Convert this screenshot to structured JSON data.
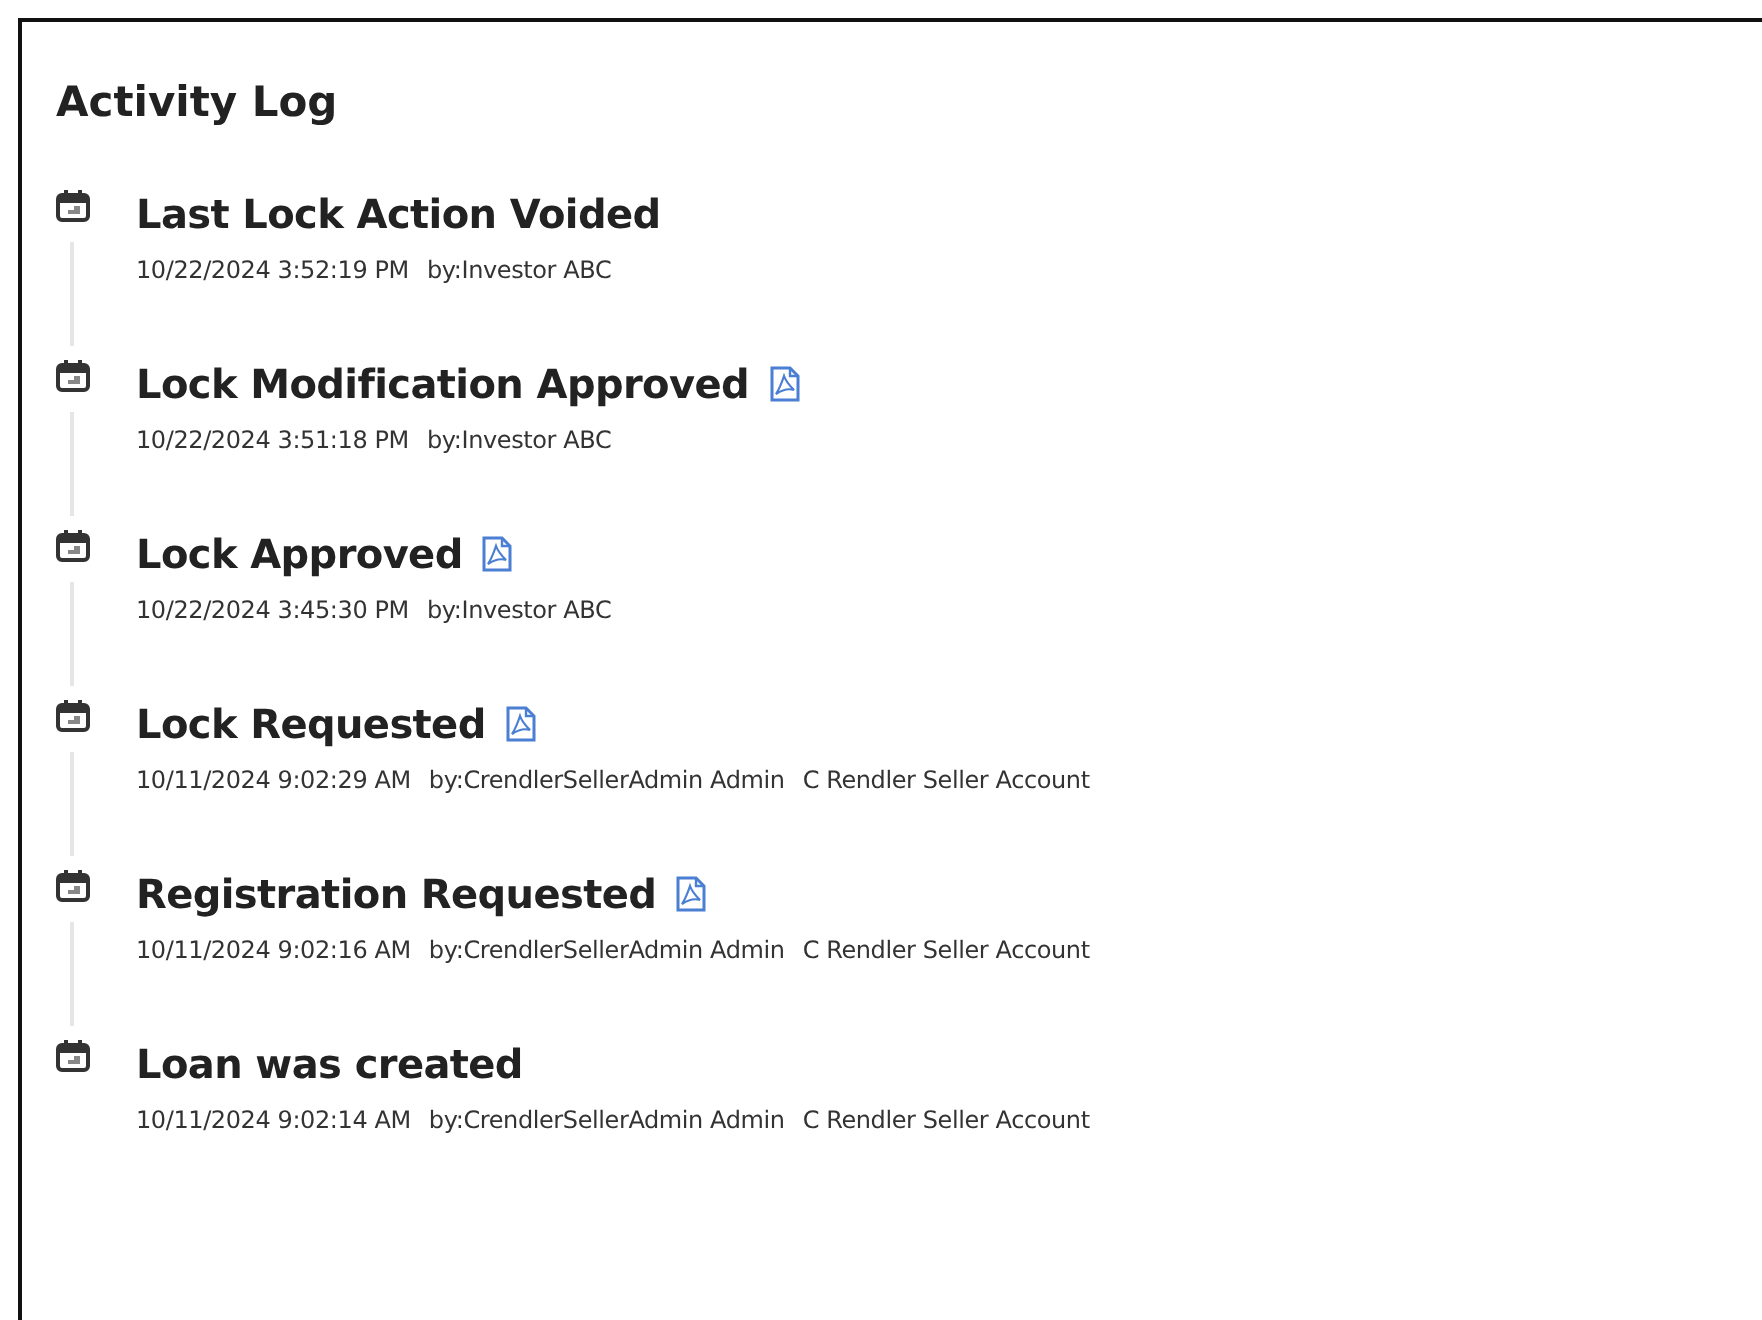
{
  "title": "Activity Log",
  "entries": [
    {
      "title": "Last Lock Action Voided",
      "attachment": false,
      "meta": [
        "10/22/2024 3:52:19 PM",
        "by:Investor ABC"
      ]
    },
    {
      "title": "Lock Modification Approved",
      "attachment": true,
      "meta": [
        "10/22/2024 3:51:18 PM",
        "by:Investor ABC"
      ]
    },
    {
      "title": "Lock Approved",
      "attachment": true,
      "meta": [
        "10/22/2024 3:45:30 PM",
        "by:Investor ABC"
      ]
    },
    {
      "title": "Lock Requested",
      "attachment": true,
      "meta": [
        "10/11/2024 9:02:29 AM",
        "by:CrendlerSellerAdmin Admin",
        "C Rendler Seller Account"
      ]
    },
    {
      "title": "Registration Requested",
      "attachment": true,
      "meta": [
        "10/11/2024 9:02:16 AM",
        "by:CrendlerSellerAdmin Admin",
        "C Rendler Seller Account"
      ]
    },
    {
      "title": "Loan was created",
      "attachment": false,
      "meta": [
        "10/11/2024 9:02:14 AM",
        "by:CrendlerSellerAdmin Admin",
        "C Rendler Seller Account"
      ]
    }
  ]
}
